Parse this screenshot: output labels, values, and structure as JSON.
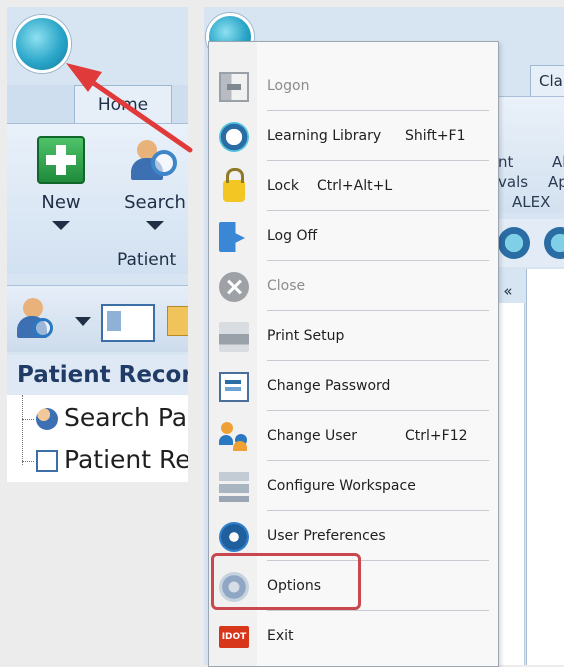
{
  "left_panel": {
    "ribbon_tab": "Home",
    "buttons": [
      {
        "label": "New",
        "icon": "new-icon"
      },
      {
        "label": "Search",
        "icon": "search-icon"
      }
    ],
    "group_label": "Patient",
    "section_title": "Patient Record",
    "tree_items": [
      "Search Pa",
      "Patient Re"
    ]
  },
  "background_app": {
    "tab_claims": "Clai",
    "ribbon_texts": [
      "nt",
      "vals",
      "Al",
      "Ap",
      "ALEX"
    ],
    "collapse_glyph": "«"
  },
  "app_menu": {
    "items": [
      {
        "label": "Logon",
        "shortcut": "",
        "icon": "logon-icon",
        "enabled": false
      },
      {
        "label": "Learning Library",
        "shortcut": "Shift+F1",
        "icon": "learning-library-icon",
        "enabled": true
      },
      {
        "label": "Lock",
        "shortcut": "Ctrl+Alt+L",
        "icon": "lock-icon",
        "enabled": true
      },
      {
        "label": "Log Off",
        "shortcut": "",
        "icon": "log-off-icon",
        "enabled": true
      },
      {
        "label": "Close",
        "shortcut": "",
        "icon": "close-icon",
        "enabled": false
      },
      {
        "label": "Print Setup",
        "shortcut": "",
        "icon": "print-icon",
        "enabled": true
      },
      {
        "label": "Change Password",
        "shortcut": "",
        "icon": "password-icon",
        "enabled": true
      },
      {
        "label": "Change User",
        "shortcut": "Ctrl+F12",
        "icon": "change-user-icon",
        "enabled": true
      },
      {
        "label": "Configure Workspace",
        "shortcut": "",
        "icon": "workspace-icon",
        "enabled": true
      },
      {
        "label": "User Preferences",
        "shortcut": "",
        "icon": "preferences-icon",
        "enabled": true
      },
      {
        "label": "Options",
        "shortcut": "",
        "icon": "options-icon",
        "enabled": true
      },
      {
        "label": "Exit",
        "shortcut": "",
        "icon": "exit-icon",
        "enabled": true
      }
    ],
    "exit_icon_text": "IDOT"
  },
  "annotation": {
    "highlight_color": "#c9474e",
    "arrow_color": "#e03a3a"
  }
}
